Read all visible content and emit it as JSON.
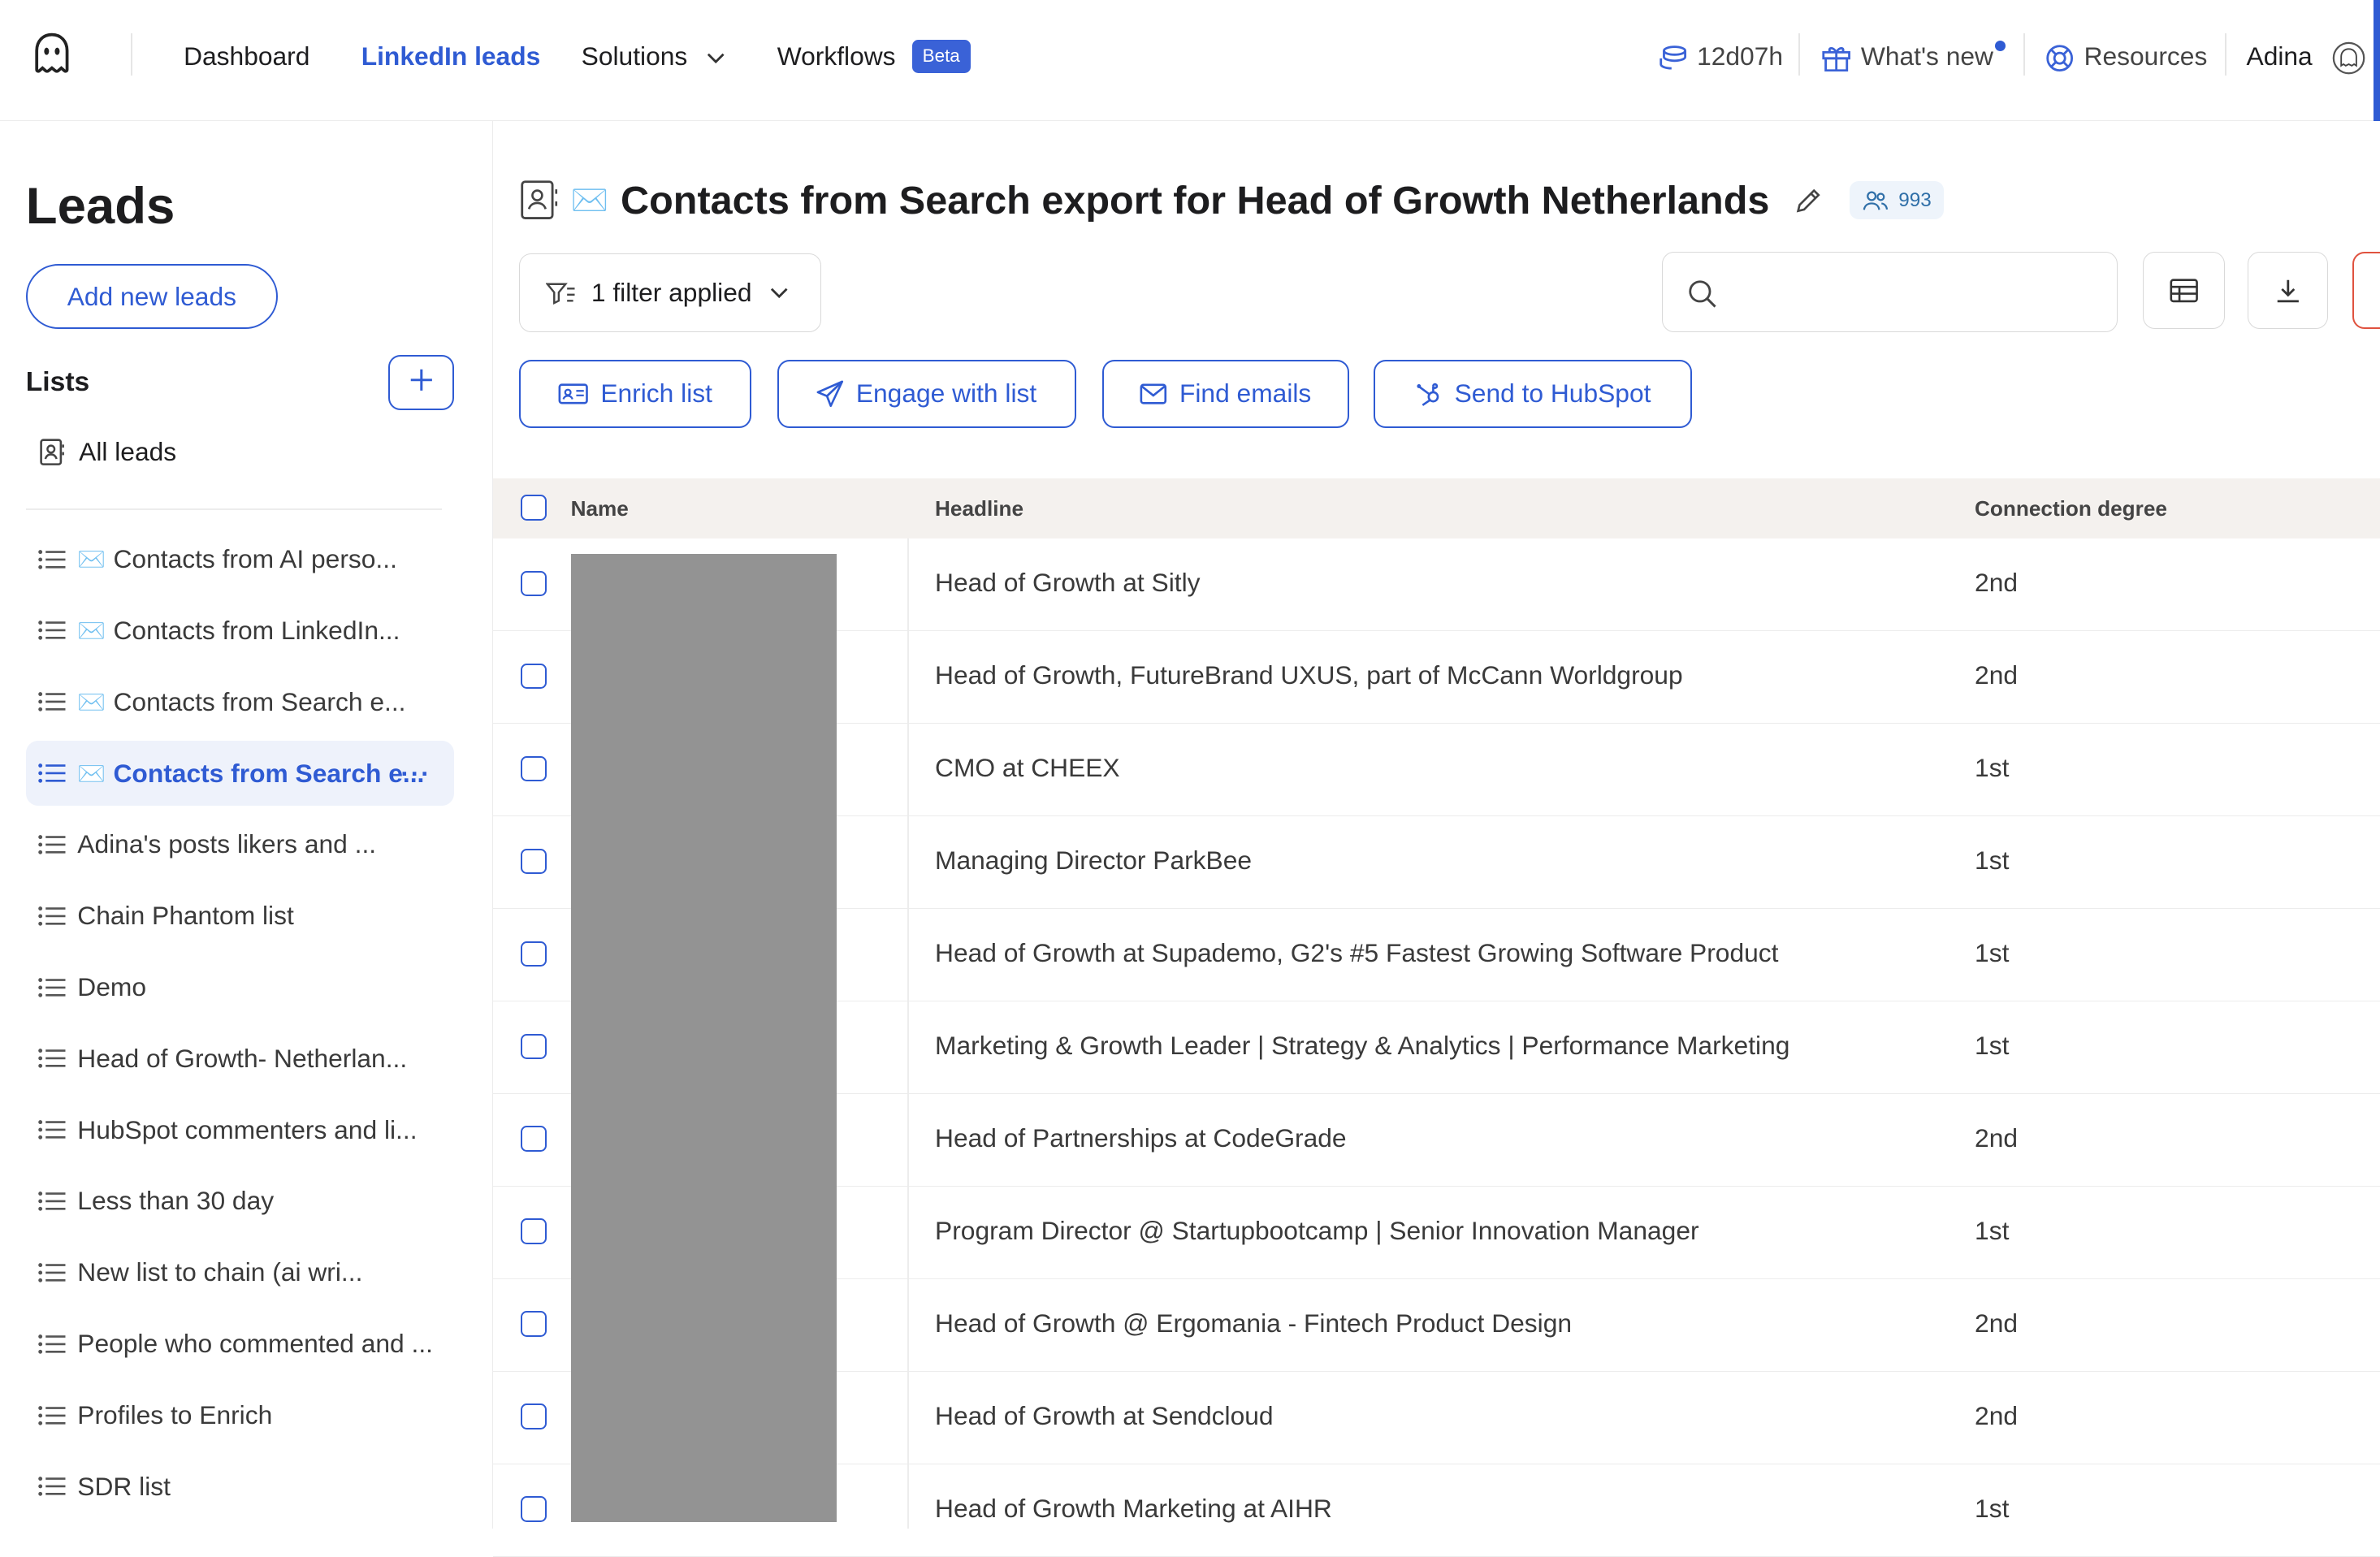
{
  "nav": {
    "logo_icon": "ghost-icon",
    "items": [
      {
        "label": "Dashboard"
      },
      {
        "label": "LinkedIn leads"
      },
      {
        "label": "Solutions"
      },
      {
        "label": "Workflows"
      }
    ],
    "beta_badge": "Beta",
    "time_credit": "12d07h",
    "whats_new": "What's new",
    "resources": "Resources",
    "user_name": "Adina",
    "accent_color": "#2f5bd3"
  },
  "sidebar": {
    "title": "Leads",
    "add_button": "Add new leads",
    "lists_label": "Lists",
    "all_leads": "All leads",
    "lists": [
      {
        "label": "Contacts from AI perso...",
        "envelope": true
      },
      {
        "label": "Contacts from LinkedIn...",
        "envelope": true
      },
      {
        "label": "Contacts from Search e...",
        "envelope": true
      },
      {
        "label": "Contacts from Search e...",
        "envelope": true,
        "active": true
      },
      {
        "label": "Adina's posts likers and ..."
      },
      {
        "label": "Chain Phantom list"
      },
      {
        "label": "Demo"
      },
      {
        "label": "Head of Growth- Netherlan..."
      },
      {
        "label": "HubSpot commenters and li..."
      },
      {
        "label": "Less than 30 day"
      },
      {
        "label": "New list to chain (ai wri..."
      },
      {
        "label": "People who commented and ..."
      },
      {
        "label": "Profiles to Enrich"
      },
      {
        "label": "SDR list"
      }
    ],
    "more_label": "···",
    "envelope_glyph": "✉️"
  },
  "main": {
    "title": "Contacts from Search export for Head of Growth Netherlands",
    "title_envelope": "✉️",
    "lead_count": "993",
    "filter_label": "1 filter applied",
    "search_placeholder": "",
    "actions": [
      {
        "label": "Enrich list",
        "icon": "id-card-icon"
      },
      {
        "label": "Engage with list",
        "icon": "paper-plane-icon"
      },
      {
        "label": "Find emails",
        "icon": "envelope-icon"
      },
      {
        "label": "Send to HubSpot",
        "icon": "hubspot-icon"
      }
    ]
  },
  "table": {
    "columns": [
      "Name",
      "Headline",
      "Connection degree"
    ],
    "rows": [
      {
        "headline": "Head of Growth at Sitly",
        "degree": "2nd"
      },
      {
        "headline": "Head of Growth, FutureBrand UXUS, part of McCann Worldgroup",
        "degree": "2nd"
      },
      {
        "headline": "CMO at CHEEX",
        "degree": "1st"
      },
      {
        "headline": "Managing Director ParkBee",
        "degree": "1st"
      },
      {
        "headline": "Head of Growth at Supademo, G2's #5 Fastest Growing Software Product",
        "degree": "1st"
      },
      {
        "headline": "Marketing & Growth Leader | Strategy & Analytics | Performance Marketing",
        "degree": "1st"
      },
      {
        "headline": "Head of Partnerships at CodeGrade",
        "degree": "2nd"
      },
      {
        "headline": "Program Director @ Startupbootcamp | Senior Innovation Manager",
        "degree": "1st"
      },
      {
        "headline": "Head of Growth @ Ergomania - Fintech Product Design",
        "degree": "2nd"
      },
      {
        "headline": "Head of Growth at Sendcloud",
        "degree": "2nd"
      },
      {
        "headline": "Head of Growth Marketing at AIHR",
        "degree": "1st"
      }
    ],
    "names_redacted": true
  }
}
